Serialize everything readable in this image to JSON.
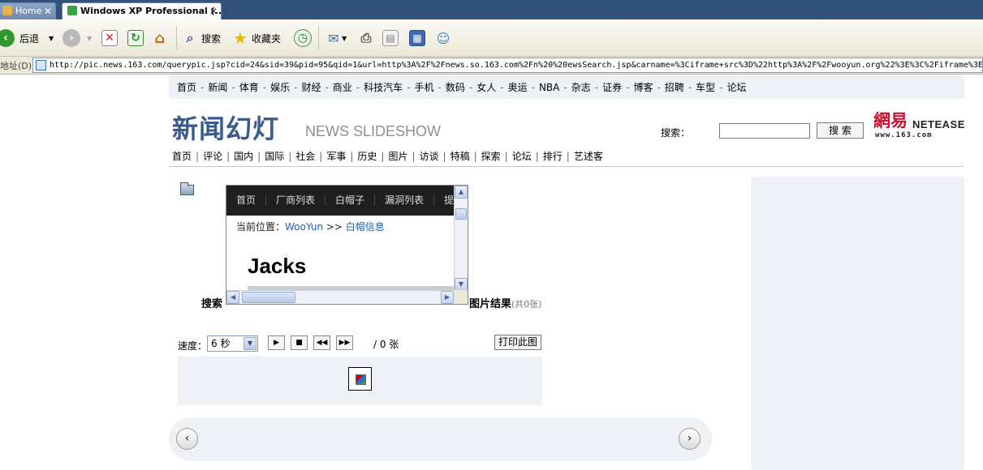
{
  "browser": {
    "tabs": [
      {
        "label": "Home",
        "active": false
      },
      {
        "label": "Windows XP Professional (...",
        "active": true
      }
    ],
    "toolbar": {
      "back_label": "后退",
      "search_label": "搜索",
      "favorites_label": "收藏夹"
    },
    "address_label": "地址(D)",
    "url": "http://pic.news.163.com/querypic.jsp?cid=24&sid=39&pid=95&qid=1&url=http%3A%2F%2Fnews.so.163.com%2Fn%20%20ewsSearch.jsp&carname=%3Ciframe+src%3D%22http%3A%2F%2Fwooyun.org%22%3E%3C%2Fiframe%3E&"
  },
  "page": {
    "top_nav": [
      "首页",
      "新闻",
      "体育",
      "娱乐",
      "财经",
      "商业",
      "科技汽车",
      "手机",
      "数码",
      "女人",
      "奥运",
      "NBA",
      "杂志",
      "证券",
      "博客",
      "招聘",
      "车型",
      "论坛"
    ],
    "logo_cn": "新闻幻灯",
    "logo_en": "NEWS SLIDESHOW",
    "search_label": "搜索：",
    "search_button": "搜 索",
    "brand_cn": "網易",
    "brand_en": "NETEASE",
    "brand_url": "www.163.com",
    "section_nav": [
      "首页",
      "评论",
      "国内",
      "国际",
      "社会",
      "军事",
      "历史",
      "图片",
      "访谈",
      "特稿",
      "探索",
      "论坛",
      "排行",
      "艺述客"
    ],
    "search_prefix": "搜索",
    "result_title": "图片结果",
    "result_count": "(共0张)",
    "speed_label": "速度：",
    "speed_value": "6 秒",
    "page_count": "/ 0 张",
    "print_button": "打印此图"
  },
  "iframe": {
    "nav": [
      "首页",
      "厂商列表",
      "白帽子",
      "漏洞列表",
      "提"
    ],
    "crumb_prefix": "当前位置：",
    "crumb_site": "WooYun",
    "crumb_sep": ">>",
    "crumb_page": "白帽信息",
    "heading": "Jacks"
  }
}
